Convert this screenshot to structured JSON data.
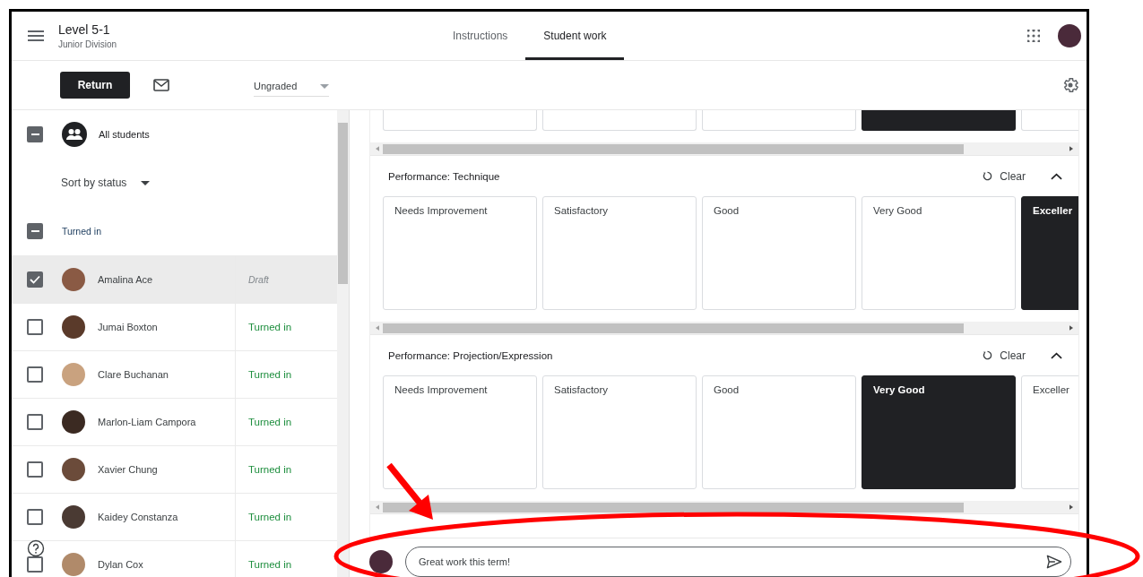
{
  "header": {
    "title": "Level 5-1",
    "subtitle": "Junior Division"
  },
  "tabs": [
    {
      "label": "Instructions",
      "selected": false
    },
    {
      "label": "Student work",
      "selected": true
    }
  ],
  "toolbar": {
    "return_button": "Return",
    "grade_filter": "Ungraded"
  },
  "student_list": {
    "all_label": "All students",
    "all_indeterminate": true,
    "sort": "Sort by status",
    "groups": [
      {
        "label": "Turned in",
        "indeterminate": true,
        "students": [
          {
            "name": "Amalina Ace",
            "status": "Draft",
            "kind": "draft",
            "checked": true,
            "selected": true
          },
          {
            "name": "Jumai Boxton",
            "status": "Turned in",
            "kind": "turned_in",
            "checked": false,
            "selected": false
          },
          {
            "name": "Clare Buchanan",
            "status": "Turned in",
            "kind": "turned_in",
            "checked": false,
            "selected": false
          },
          {
            "name": "Marlon-Liam Campora",
            "status": "Turned in",
            "kind": "turned_in",
            "checked": false,
            "selected": false
          },
          {
            "name": "Xavier Chung",
            "status": "Turned in",
            "kind": "turned_in",
            "checked": false,
            "selected": false
          },
          {
            "name": "Kaidey Constanza",
            "status": "Turned in",
            "kind": "turned_in",
            "checked": false,
            "selected": false
          },
          {
            "name": "Dylan Cox",
            "status": "Turned in",
            "kind": "turned_in",
            "checked": false,
            "selected": false
          }
        ]
      }
    ]
  },
  "rubric": [
    {
      "cards": [
        {
          "selected": false
        },
        {
          "selected": false
        },
        {
          "selected": false
        },
        {
          "selected": true
        },
        {
          "selected": false
        }
      ]
    },
    {
      "title": "Performance: Technique",
      "clear": "Clear",
      "cards": [
        {
          "label": "Needs Improvement",
          "selected": false
        },
        {
          "label": "Satisfactory",
          "selected": false
        },
        {
          "label": "Good",
          "selected": false
        },
        {
          "label": "Very Good",
          "selected": false
        },
        {
          "label": "Exceller",
          "selected": true
        }
      ]
    },
    {
      "title": "Performance: Projection/Expression",
      "clear": "Clear",
      "cards": [
        {
          "label": "Needs Improvement",
          "selected": false
        },
        {
          "label": "Satisfactory",
          "selected": false
        },
        {
          "label": "Good",
          "selected": false
        },
        {
          "label": "Very Good",
          "selected": true
        },
        {
          "label": "Exceller",
          "selected": false
        }
      ]
    }
  ],
  "comment": {
    "value": "Great work this term!"
  },
  "annotations": {
    "arrow": true,
    "ellipse": true
  }
}
